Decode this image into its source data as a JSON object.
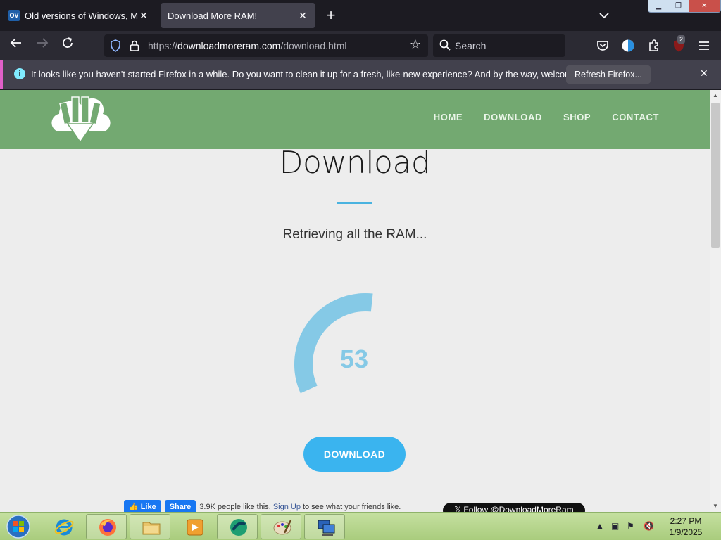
{
  "browser": {
    "tabs": [
      {
        "title": "Old versions of Windows, Mac",
        "favicon": "OV",
        "active": false
      },
      {
        "title": "Download More RAM!",
        "active": true
      }
    ],
    "url_scheme": "https://",
    "url_host": "downloadmoreram.com",
    "url_path": "/download.html",
    "search_placeholder": "Search",
    "extension_badge": "2"
  },
  "notification": {
    "message": "It looks like you haven't started Firefox in a while. Do you want to clean it up for a fresh, like-new experience? And by the way, welcome back!",
    "button_label": "Refresh Firefox..."
  },
  "site": {
    "nav": [
      "HOME",
      "DOWNLOAD",
      "SHOP",
      "CONTACT"
    ],
    "heading": "Download",
    "subtitle": "Retrieving all the RAM...",
    "progress_value": "53",
    "progress_fraction": 0.53,
    "download_button": "DOWNLOAD",
    "facebook": {
      "like": "Like",
      "share": "Share",
      "count_text": "3.9K people like this.",
      "signup_link": "Sign Up",
      "signup_suffix": "to see what your friends like."
    },
    "twitter_follow": "Follow @DownloadMoreRam"
  },
  "taskbar": {
    "time": "2:27 PM",
    "date": "1/9/2025"
  },
  "colors": {
    "header_green": "#73a971",
    "accent_blue": "#3ab4ef",
    "gauge_blue": "#85c9e6",
    "divider_blue": "#4ab3e0"
  }
}
